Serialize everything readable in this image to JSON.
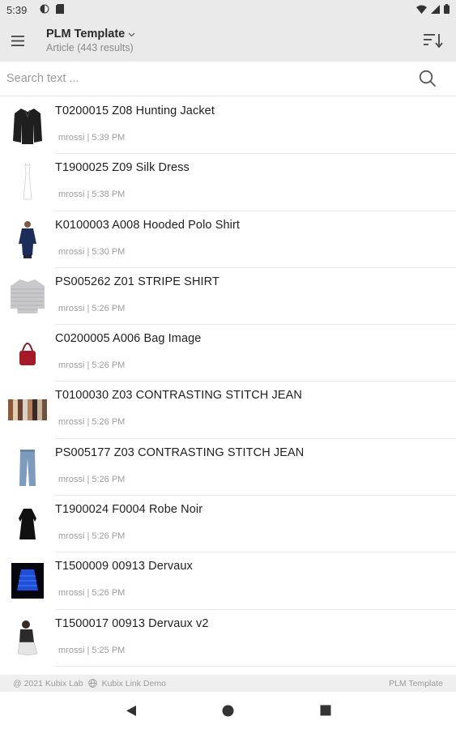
{
  "status_bar": {
    "time": "5:39"
  },
  "header": {
    "title": "PLM Template",
    "subtitle": "Article (443  results)"
  },
  "search": {
    "placeholder": "Search text ..."
  },
  "items": [
    {
      "title": "T0200015 Z08 Hunting Jacket",
      "meta": "mrossi | 5:39 PM"
    },
    {
      "title": "T1900025 Z09 Silk Dress",
      "meta": "mrossi | 5:38 PM"
    },
    {
      "title": "K0100003 A008 Hooded Polo Shirt",
      "meta": "mrossi | 5:30 PM"
    },
    {
      "title": "PS005262 Z01 STRIPE SHIRT",
      "meta": "mrossi | 5:26 PM"
    },
    {
      "title": "C0200005 A006 Bag Image",
      "meta": "mrossi | 5:26 PM"
    },
    {
      "title": "T0100030 Z03 CONTRASTING STITCH JEAN",
      "meta": "mrossi | 5:26 PM"
    },
    {
      "title": "PS005177 Z03 CONTRASTING STITCH JEAN",
      "meta": "mrossi | 5:26 PM"
    },
    {
      "title": "T1900024 F0004 Robe Noir",
      "meta": "mrossi | 5:26 PM"
    },
    {
      "title": "T1500009 00913 Dervaux",
      "meta": "mrossi | 5:26 PM"
    },
    {
      "title": "T1500017 00913 Dervaux v2",
      "meta": "mrossi | 5:25 PM"
    }
  ],
  "footer": {
    "copyright": "@ 2021 Kubix Lab",
    "demo": "Kubix Link Demo",
    "template": "PLM Template"
  }
}
